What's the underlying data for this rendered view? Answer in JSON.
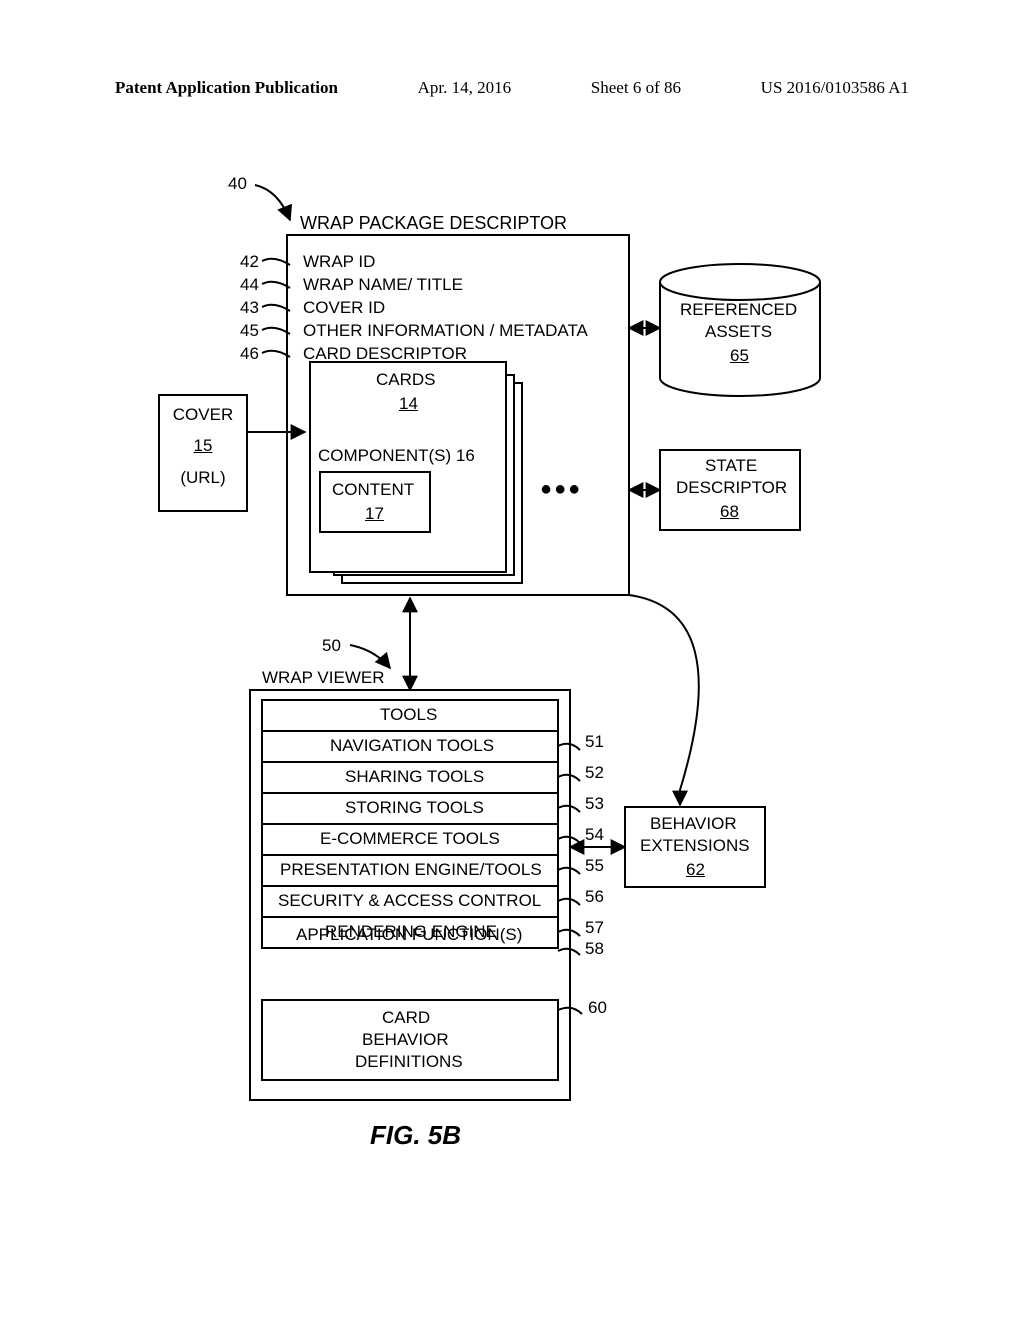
{
  "header": {
    "left": "Patent Application Publication",
    "date": "Apr. 14, 2016",
    "sheet": "Sheet 6 of 86",
    "pubno": "US 2016/0103586 A1"
  },
  "figure_label": "FIG. 5B",
  "descriptor": {
    "ref": "40",
    "title": "WRAP PACKAGE DESCRIPTOR",
    "items": {
      "wrap_id": {
        "ref": "42",
        "label": "WRAP ID"
      },
      "wrap_name": {
        "ref": "44",
        "label": "WRAP NAME/ TITLE"
      },
      "cover_id": {
        "ref": "43",
        "label": "COVER ID"
      },
      "meta": {
        "ref": "45",
        "label": "OTHER INFORMATION / METADATA"
      },
      "card_desc": {
        "ref": "46",
        "label": "CARD DESCRIPTOR"
      }
    }
  },
  "cover": {
    "label": "COVER",
    "ref": "15",
    "sub": "(URL)"
  },
  "cards": {
    "label": "CARDS",
    "ref": "14",
    "components_label": "COMPONENT(S) 16",
    "content_label": "CONTENT",
    "content_ref": "17"
  },
  "ellipsis": "●●●",
  "referenced_assets": {
    "label1": "REFERENCED",
    "label2": "ASSETS",
    "ref": "65"
  },
  "state_descriptor": {
    "label1": "STATE",
    "label2": "DESCRIPTOR",
    "ref": "68"
  },
  "behavior_ext": {
    "label1": "BEHAVIOR",
    "label2": "EXTENSIONS",
    "ref": "62"
  },
  "viewer": {
    "ref": "50",
    "title": "WRAP VIEWER",
    "tools_title": "TOOLS",
    "tools": [
      {
        "ref": "51",
        "label": "NAVIGATION TOOLS"
      },
      {
        "ref": "52",
        "label": "SHARING TOOLS"
      },
      {
        "ref": "53",
        "label": "STORING TOOLS"
      },
      {
        "ref": "54",
        "label": "E-COMMERCE TOOLS"
      },
      {
        "ref": "55",
        "label": "PRESENTATION ENGINE/TOOLS"
      },
      {
        "ref": "56",
        "label": "SECURITY & ACCESS CONTROL"
      },
      {
        "ref": "57",
        "label": "RENDERING ENGINE"
      },
      {
        "ref": "58",
        "label": "APPLICATION FUNCTION(S)"
      }
    ],
    "card_behavior": {
      "ref": "60",
      "label1": "CARD",
      "label2": "BEHAVIOR",
      "label3": "DEFINITIONS"
    }
  }
}
